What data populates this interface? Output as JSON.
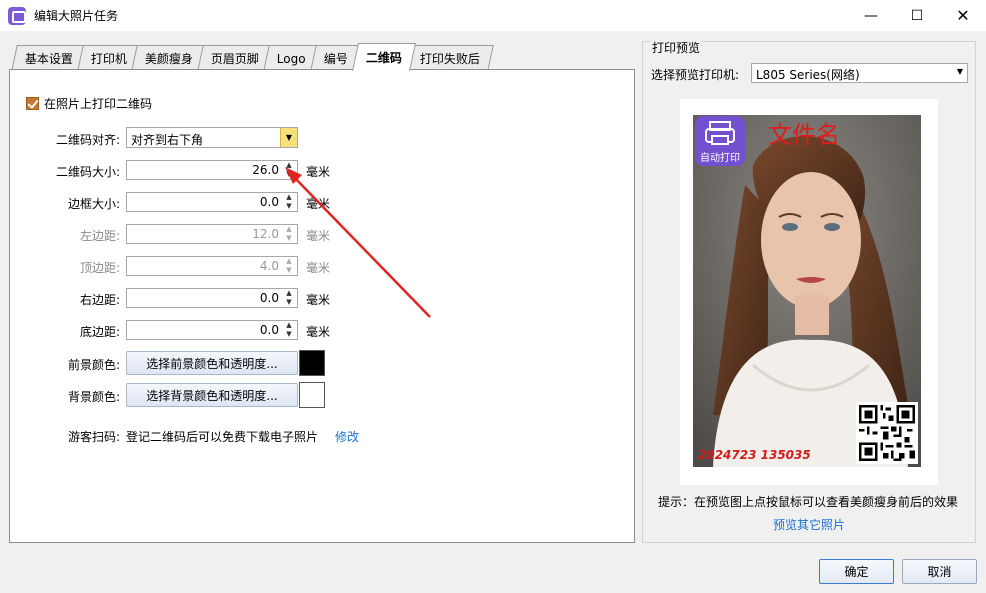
{
  "window": {
    "title": "编辑大照片任务"
  },
  "tabs": [
    {
      "label": "基本设置",
      "active": false
    },
    {
      "label": "打印机",
      "active": false
    },
    {
      "label": "美颜瘦身",
      "active": false
    },
    {
      "label": "页眉页脚",
      "active": false
    },
    {
      "label": "Logo",
      "active": false
    },
    {
      "label": "编号",
      "active": false
    },
    {
      "label": "二维码",
      "active": true
    },
    {
      "label": "打印失败后",
      "active": false
    }
  ],
  "qrcode": {
    "print_checkbox_label": "在照片上打印二维码",
    "align_label": "二维码对齐:",
    "align_value": "对齐到右下角",
    "size_label": "二维码大小:",
    "size_value": "26.0",
    "border_label": "边框大小:",
    "border_value": "0.0",
    "left_margin_label": "左边距:",
    "left_margin_value": "12.0",
    "top_margin_label": "顶边距:",
    "top_margin_value": "4.0",
    "right_margin_label": "右边距:",
    "right_margin_value": "0.0",
    "bottom_margin_label": "底边距:",
    "bottom_margin_value": "0.0",
    "unit": "毫米",
    "fg_label": "前景颜色:",
    "fg_button": "选择前景颜色和透明度...",
    "fg_color": "#000000",
    "bg_label": "背景颜色:",
    "bg_button": "选择背景颜色和透明度...",
    "bg_color": "#ffffff",
    "visitor_label": "游客扫码:",
    "visitor_text": "登记二维码后可以免费下载电子照片",
    "visitor_edit": "修改"
  },
  "preview": {
    "group_title": "打印预览",
    "printer_label": "选择预览打印机:",
    "printer_value": "L805 Series(网络)",
    "photo_name": "文件名",
    "photo_id": "2024723  135035",
    "badge_text": "自动打印",
    "hint": "提示：在预览图上点按鼠标可以查看美颜瘦身前后的效果",
    "more_link": "预览其它照片"
  },
  "buttons": {
    "ok": "确定",
    "cancel": "取消"
  }
}
